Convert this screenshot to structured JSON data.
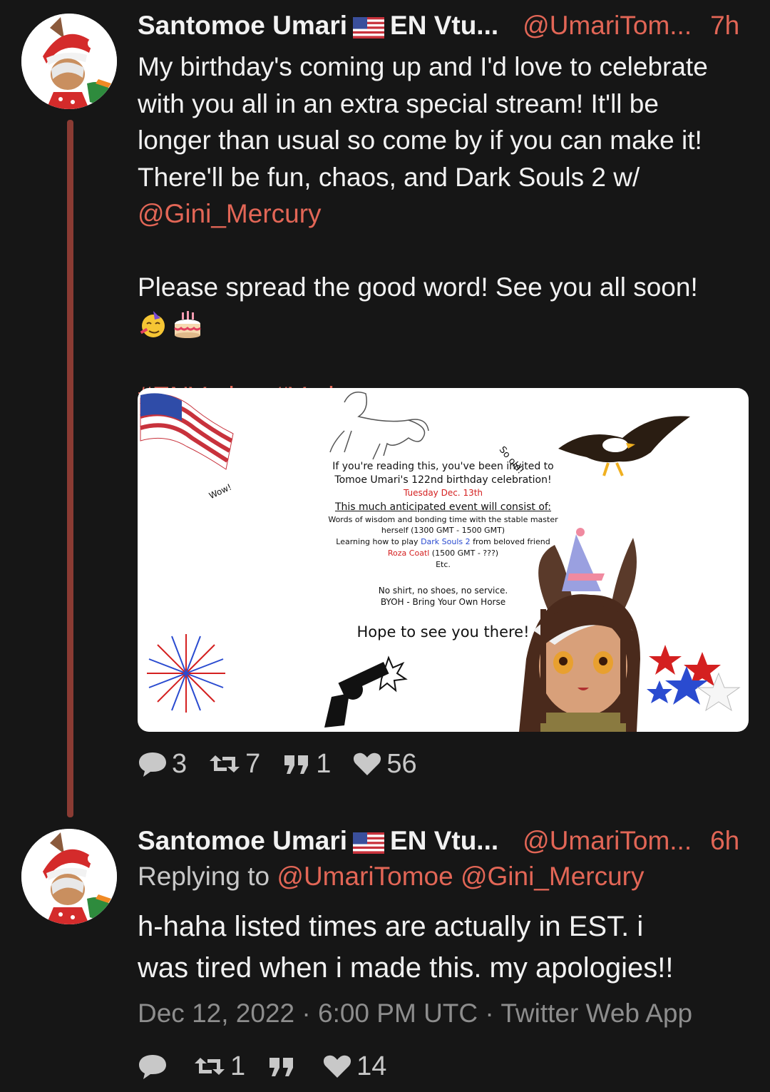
{
  "tweet1": {
    "name": "Santomoe Umari",
    "name_suffix": "EN Vtu...",
    "handle": "@UmariTom...",
    "time": "7h",
    "text_line1": "My birthday's coming up and I'd love to celebrate",
    "text_line2": "with you all in an extra special stream! It'll be",
    "text_line3": "longer than usual so come by if you can make it!",
    "text_line4": "There'll be fun, chaos, and Dark Souls 2 w/",
    "mention": "@Gini_Mercury",
    "text_para2": "Please spread the good word! See you all soon!",
    "hashtags": "#ENVtuber #Vtuber",
    "stats": {
      "replies": "3",
      "retweets": "7",
      "quotes": "1",
      "likes": "56"
    },
    "invitation": {
      "wow": "Wow!",
      "so_old": "So old!",
      "line1": "If you're reading this, you've been invited to",
      "line2": "Tomoe Umari's 122nd birthday celebration!",
      "date": "Tuesday Dec. 13th",
      "heading": "This much anticipated event will consist of:",
      "item1a": "Words of wisdom and bonding time with the stable master",
      "item1b": "herself (1300 GMT - 1500 GMT)",
      "item2_pre": "Learning how to play ",
      "item2_game": "Dark Souls 2",
      "item2_post": " from beloved friend",
      "item3_name": "Roza Coatl",
      "item3_time": " (1500 GMT - ???)",
      "etc": "Etc.",
      "rule1": "No shirt, no shoes, no service.",
      "rule2": "BYOH - Bring Your Own Horse",
      "closing": "Hope to see you there!"
    }
  },
  "tweet2": {
    "name": "Santomoe Umari",
    "name_suffix": "EN Vtu...",
    "handle": "@UmariTom...",
    "time": "6h",
    "replying_label": "Replying to",
    "replying_to1": "@UmariTomoe",
    "replying_to2": "@Gini_Mercury",
    "text_line1": "h-haha listed times are actually in EST. i",
    "text_line2": "was tired when i made this. my apologies!!",
    "date": "Dec 12, 2022",
    "time_full": "6:00 PM UTC",
    "source": "Twitter Web App",
    "stats": {
      "retweets": "1",
      "likes": "14"
    }
  },
  "colors": {
    "accent": "#e26656",
    "background": "#161616",
    "thread_line": "#8a3b33"
  },
  "icons": [
    "reply-icon",
    "retweet-icon",
    "quote-icon",
    "heart-icon",
    "us-flag-icon"
  ]
}
